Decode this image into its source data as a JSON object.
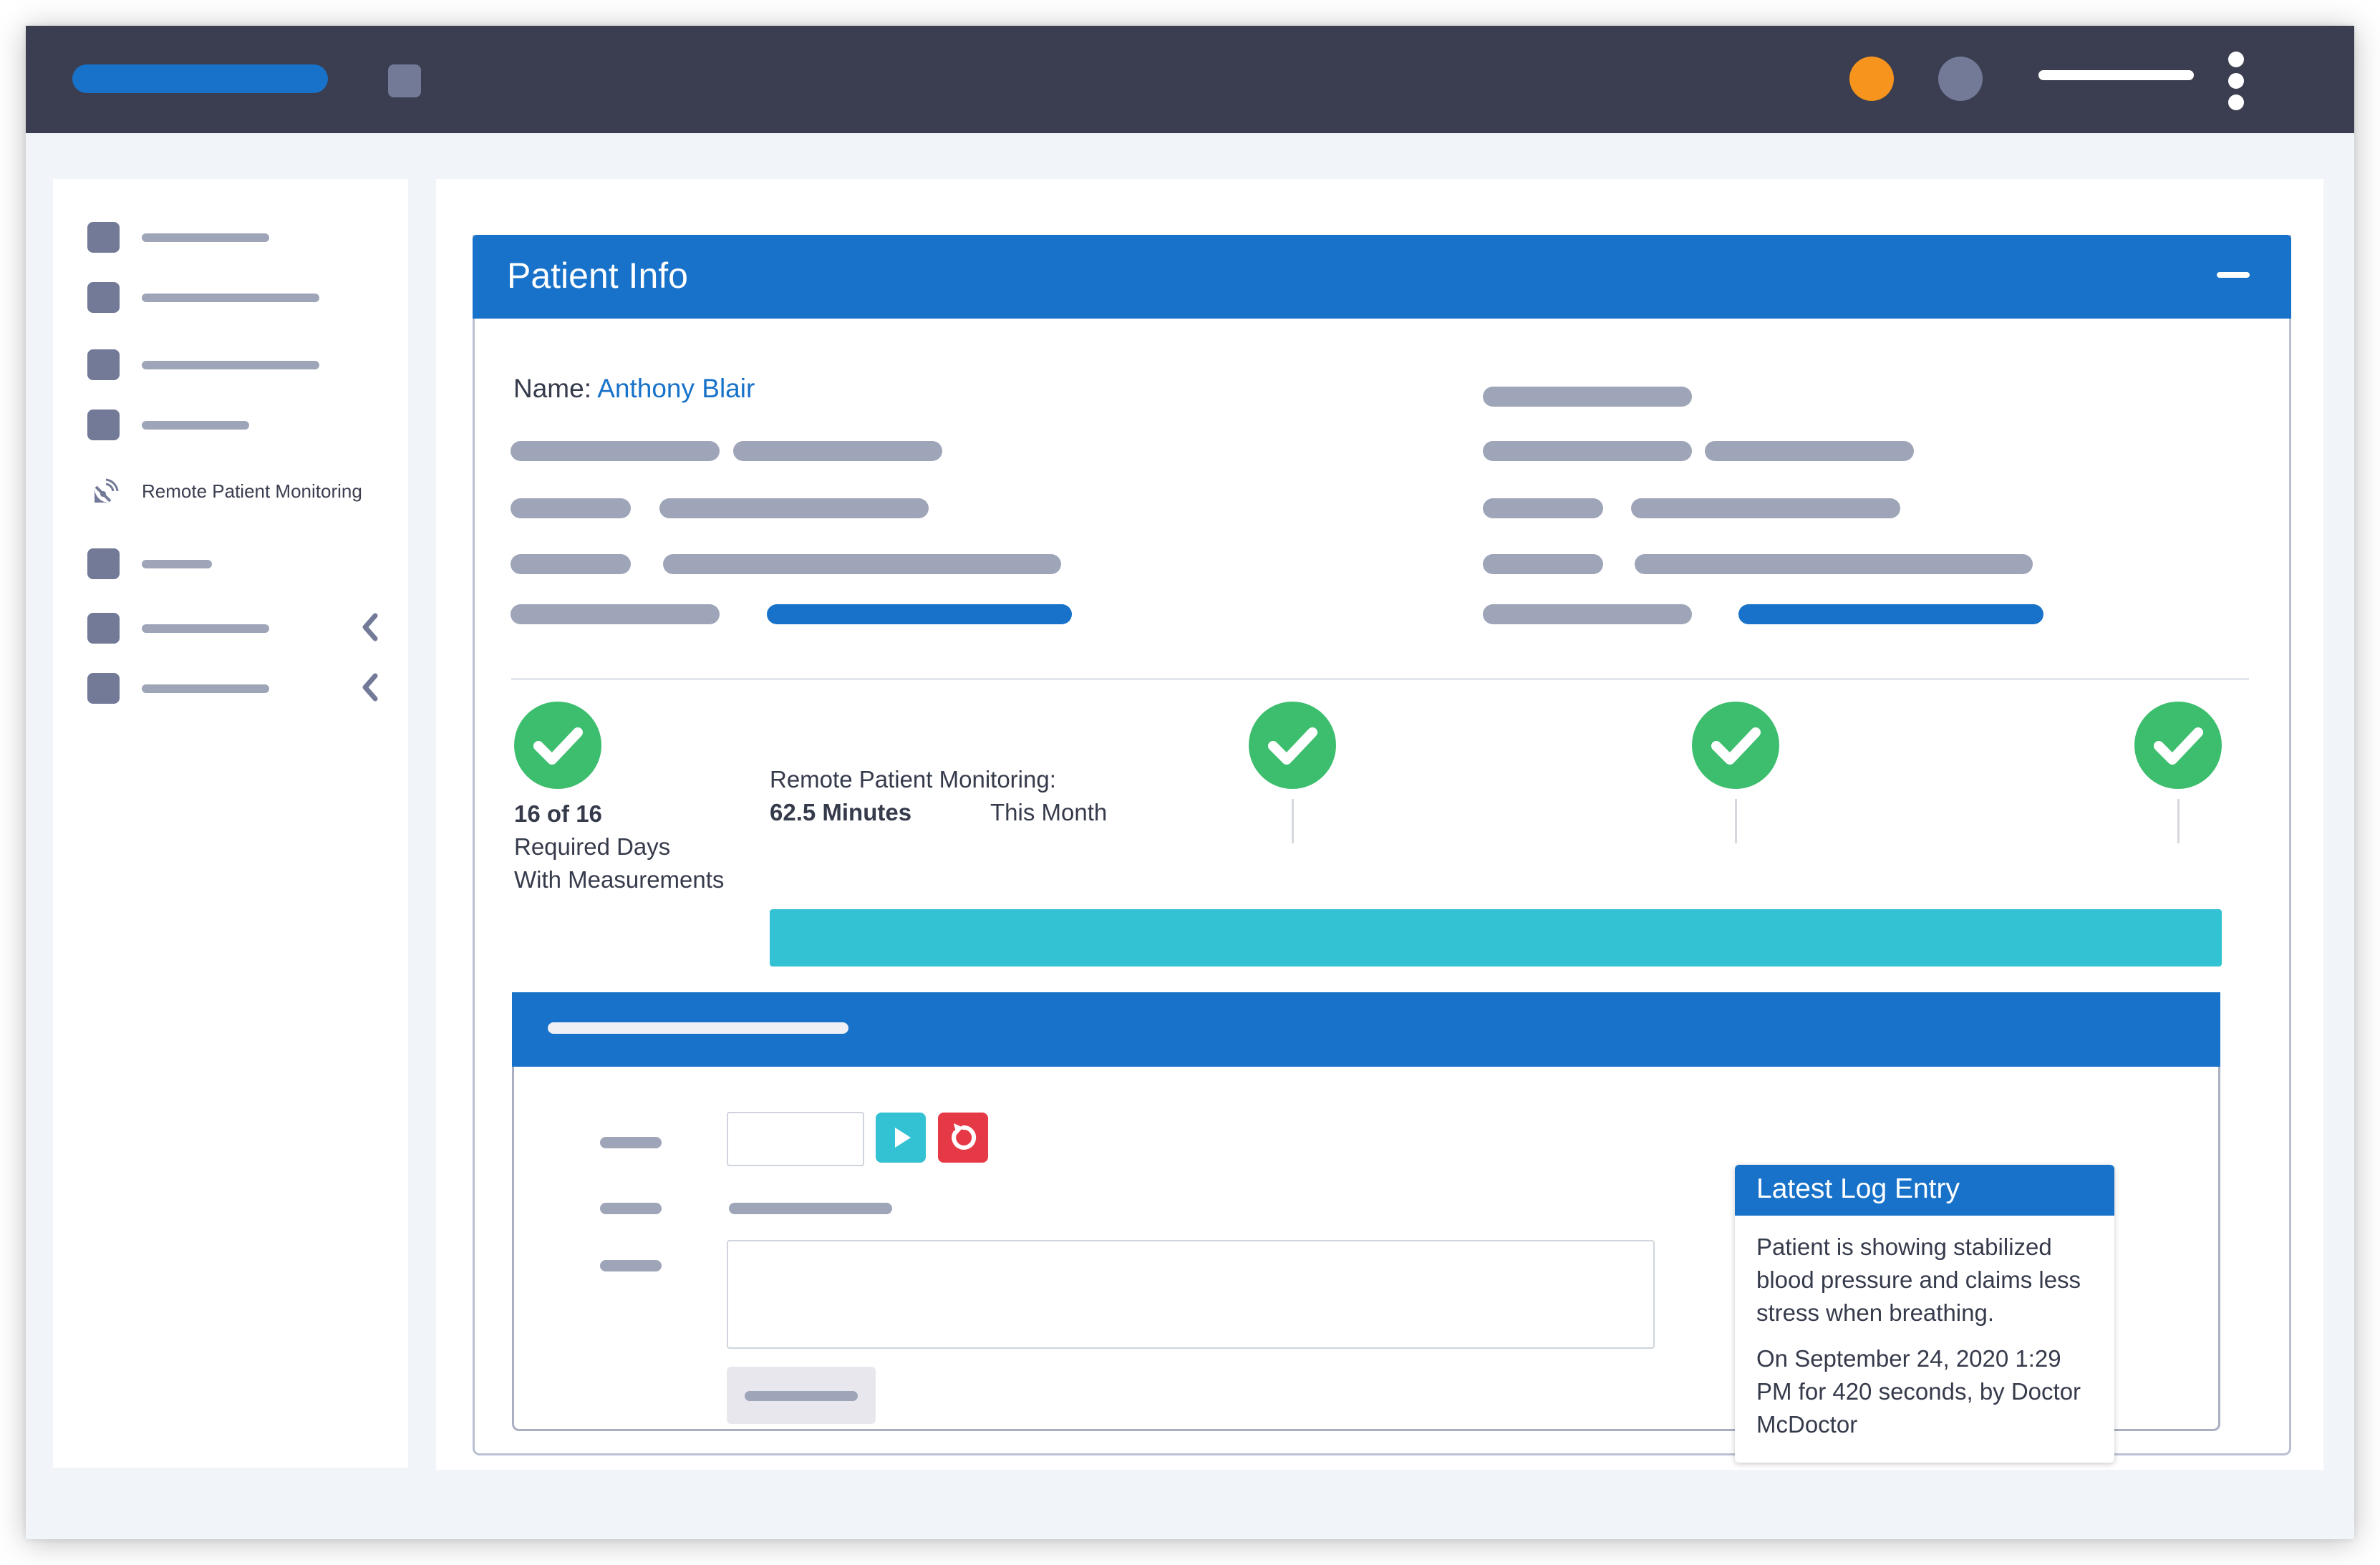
{
  "topbar": {
    "icons": [
      "notification-dot-orange",
      "user-avatar-dot",
      "more-vert-icon"
    ],
    "colors": {
      "background": "#3b3e50",
      "accent": "#1872c9",
      "notification": "#f7941d",
      "avatar": "#737a97"
    }
  },
  "sidebar": {
    "items": [
      {
        "label": "",
        "icon": "nav-square-icon"
      },
      {
        "label": "",
        "icon": "nav-square-icon"
      },
      {
        "label": "",
        "icon": "nav-square-icon"
      },
      {
        "label": "",
        "icon": "nav-square-icon"
      },
      {
        "label": "Remote Patient Monitoring",
        "icon": "satellite-dish-icon"
      },
      {
        "label": "",
        "icon": "nav-square-icon"
      },
      {
        "label": "",
        "icon": "nav-square-icon",
        "expandable": true
      },
      {
        "label": "",
        "icon": "nav-square-icon",
        "expandable": true
      }
    ]
  },
  "patient_panel": {
    "title": "Patient Info",
    "name_label": "Name:",
    "name_value": "Anthony Blair"
  },
  "monitoring": {
    "days_count": "16 of 16",
    "days_label_1": "Required Days",
    "days_label_2": "With Measurements",
    "rpm_label": "Remote Patient Monitoring:",
    "minutes": "62.5 Minutes",
    "period": "This Month",
    "progress_fraction": 1.0,
    "milestones_completed": 3,
    "colors": {
      "progress": "#33c2d3",
      "check": "#3dbe6e"
    }
  },
  "log_card": {
    "title": "Latest Log Entry",
    "note": "Patient is showing stabilized blood pressure and claims less stress when breathing.",
    "meta": "On September 24, 2020 1:29 PM for 420 seconds, by Doctor McDoctor"
  },
  "timer": {
    "colors": {
      "play": "#33c2d3",
      "reset": "#e63946"
    }
  }
}
